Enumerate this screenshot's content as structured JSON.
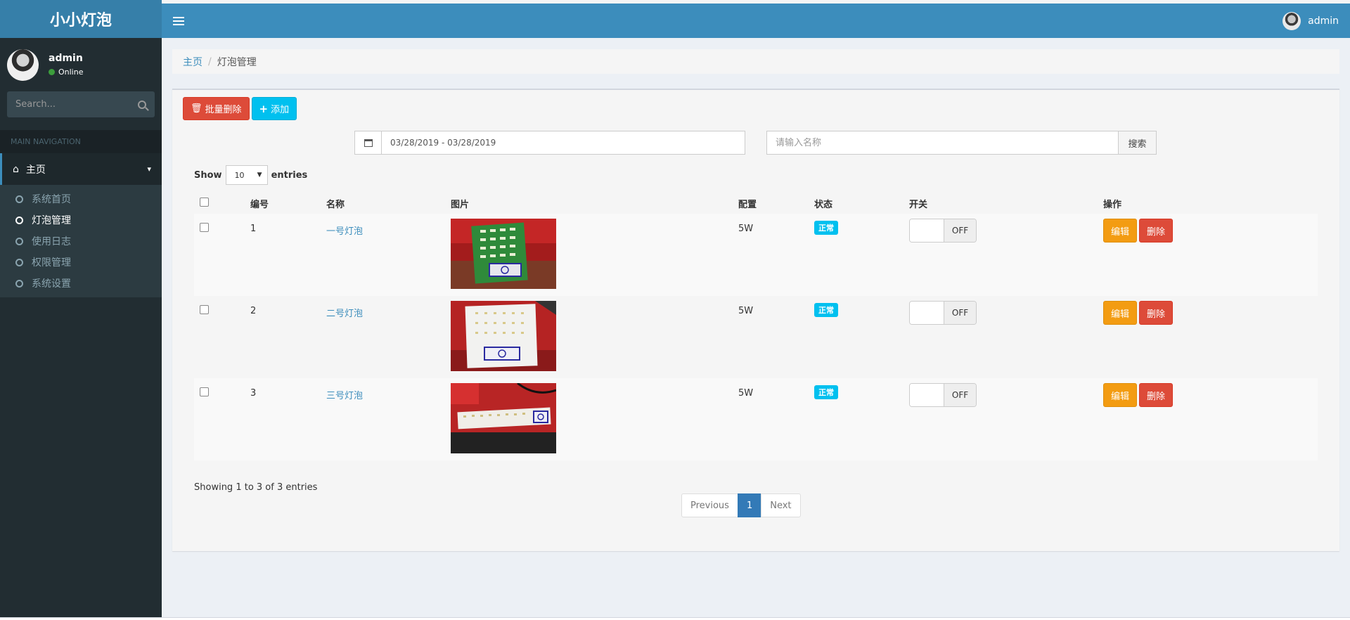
{
  "app": {
    "logo": "小小灯泡"
  },
  "header": {
    "user_name": "admin"
  },
  "sidebar": {
    "user_name": "admin",
    "status": "Online",
    "search_placeholder": "Search...",
    "nav_header": "MAIN NAVIGATION",
    "main_item": "主页",
    "items": [
      {
        "label": "系统首页"
      },
      {
        "label": "灯泡管理"
      },
      {
        "label": "使用日志"
      },
      {
        "label": "权限管理"
      },
      {
        "label": "系统设置"
      }
    ]
  },
  "breadcrumb": {
    "home": "主页",
    "current": "灯泡管理"
  },
  "toolbar": {
    "batch_delete": "批量删除",
    "add": "添加"
  },
  "filters": {
    "date_range": "03/28/2019 - 03/28/2019",
    "name_placeholder": "请输入名称",
    "search_button": "搜索"
  },
  "table": {
    "show_label": "Show",
    "entries_label": "entries",
    "page_size": "10",
    "headers": [
      "编号",
      "名称",
      "图片",
      "配置",
      "状态",
      "开关",
      "操作"
    ],
    "rows": [
      {
        "id": "1",
        "name": "一号灯泡",
        "config": "5W",
        "status": "正常",
        "switch": "OFF",
        "edit": "编辑",
        "delete": "删除"
      },
      {
        "id": "2",
        "name": "二号灯泡",
        "config": "5W",
        "status": "正常",
        "switch": "OFF",
        "edit": "编辑",
        "delete": "删除"
      },
      {
        "id": "3",
        "name": "三号灯泡",
        "config": "5W",
        "status": "正常",
        "switch": "OFF",
        "edit": "编辑",
        "delete": "删除"
      }
    ],
    "info": "Showing 1 to 3 of 3 entries"
  },
  "pagination": {
    "previous": "Previous",
    "current": "1",
    "next": "Next"
  },
  "colors": {
    "primary": "#3c8dbc",
    "danger": "#dd4b39",
    "info": "#00c0ef",
    "warning": "#f39c12",
    "sidebar": "#222d32"
  }
}
